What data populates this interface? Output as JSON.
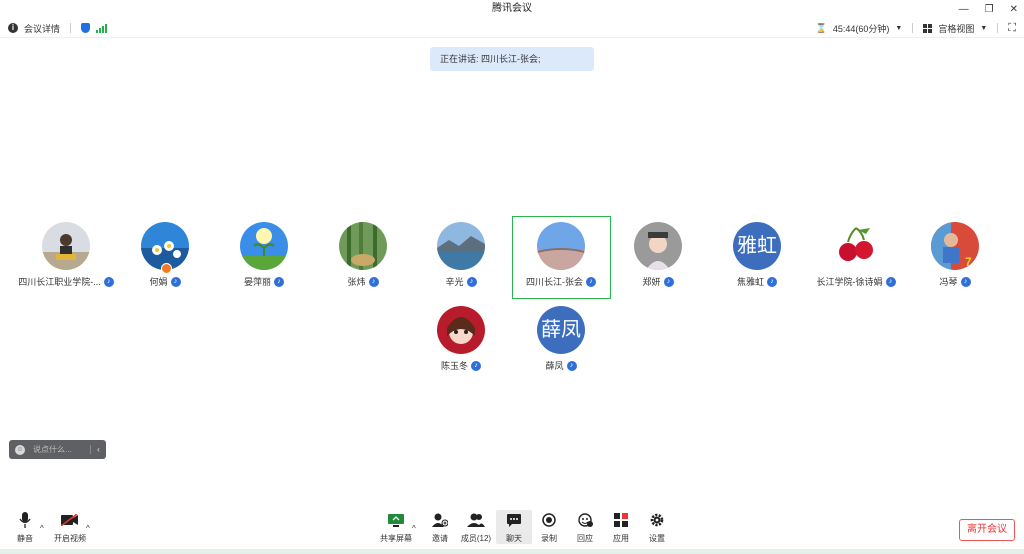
{
  "window": {
    "title": "腾讯会议"
  },
  "topbar": {
    "meeting_details": "会议详情",
    "timer": "45:44(60分钟)",
    "view_mode": "宫格视图"
  },
  "speaking_banner": "正在讲话: 四川长江-张会;",
  "participants": [
    {
      "name": "四川长江职业学院-...",
      "avatar": "photo-child"
    },
    {
      "name": "何娟",
      "avatar": "photo-flowers",
      "host": true
    },
    {
      "name": "晏萍丽",
      "avatar": "photo-sprout"
    },
    {
      "name": "张炜",
      "avatar": "photo-bamboo"
    },
    {
      "name": "辛光",
      "avatar": "photo-lake"
    },
    {
      "name": "四川长江-张会",
      "avatar": "photo-sky",
      "active": true
    },
    {
      "name": "郑妍",
      "avatar": "photo-girl"
    },
    {
      "name": "焦雅虹",
      "avatar_text": "雅虹"
    },
    {
      "name": "长江学院-徐诗娟",
      "avatar": "photo-cherry"
    },
    {
      "name": "冯琴",
      "avatar": "photo-kid"
    },
    {
      "name": "陈玉冬",
      "avatar": "photo-cartoon"
    },
    {
      "name": "薛凤",
      "avatar_text": "薛凤"
    }
  ],
  "chat": {
    "placeholder": "说点什么..."
  },
  "toolbar": {
    "mute": "静音",
    "start_video": "开启视频",
    "share_screen": "共享屏幕",
    "invite": "邀请",
    "members": "成员(12)",
    "chat": "聊天",
    "record": "录制",
    "replay": "回应",
    "apps": "应用",
    "settings": "设置",
    "leave": "离开会议"
  },
  "colors": {
    "accent": "#2f6fd9",
    "active_speaker_border": "#2bb34f",
    "leave": "#e33333",
    "speaking_banner_bg": "#dce9fb"
  }
}
